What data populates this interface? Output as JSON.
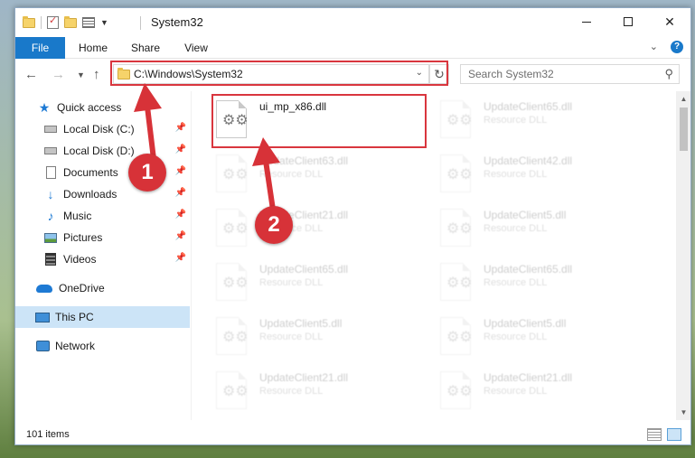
{
  "window": {
    "title": "System32"
  },
  "ribbon": {
    "tabs": [
      "File",
      "Home",
      "Share",
      "View"
    ]
  },
  "address": {
    "path": "C:\\Windows\\System32"
  },
  "search": {
    "placeholder": "Search System32"
  },
  "navpane": {
    "items": [
      {
        "label": "Quick access",
        "icon": "star-icon",
        "pinned": false
      },
      {
        "label": "Local Disk (C:)",
        "icon": "drive-icon",
        "pinned": true
      },
      {
        "label": "Local Disk (D:)",
        "icon": "drive-icon",
        "pinned": true
      },
      {
        "label": "Documents",
        "icon": "documents-icon",
        "pinned": true
      },
      {
        "label": "Downloads",
        "icon": "downloads-icon",
        "pinned": true
      },
      {
        "label": "Music",
        "icon": "music-icon",
        "pinned": true
      },
      {
        "label": "Pictures",
        "icon": "pictures-icon",
        "pinned": true
      },
      {
        "label": "Videos",
        "icon": "videos-icon",
        "pinned": true
      },
      {
        "label": "OneDrive",
        "icon": "onedrive-icon",
        "pinned": false
      },
      {
        "label": "This PC",
        "icon": "this-pc-icon",
        "pinned": false,
        "selected": true
      },
      {
        "label": "Network",
        "icon": "network-icon",
        "pinned": false
      }
    ]
  },
  "files": {
    "highlighted": {
      "name": "ui_mp_x86.dll",
      "type": ""
    },
    "col1": [
      {
        "name": "UpdateClient63.dll",
        "type": "Resource DLL"
      },
      {
        "name": "UpdateClient21.dll",
        "type": "Resource DLL"
      },
      {
        "name": "UpdateClient65.dll",
        "type": "Resource DLL"
      },
      {
        "name": "UpdateClient5.dll",
        "type": "Resource DLL"
      },
      {
        "name": "UpdateClient21.dll",
        "type": "Resource DLL"
      }
    ],
    "col2": [
      {
        "name": "UpdateClient65.dll",
        "type": "Resource DLL"
      },
      {
        "name": "UpdateClient42.dll",
        "type": "Resource DLL"
      },
      {
        "name": "UpdateClient5.dll",
        "type": "Resource DLL"
      },
      {
        "name": "UpdateClient65.dll",
        "type": "Resource DLL"
      },
      {
        "name": "UpdateClient5.dll",
        "type": "Resource DLL"
      },
      {
        "name": "UpdateClient21.dll",
        "type": "Resource DLL"
      }
    ]
  },
  "status": {
    "item_count": "101 items"
  },
  "callouts": {
    "one": "1",
    "two": "2"
  },
  "colors": {
    "accent": "#1979ca",
    "annotation_red": "#d9363e",
    "selected_bg": "#cce4f7"
  }
}
